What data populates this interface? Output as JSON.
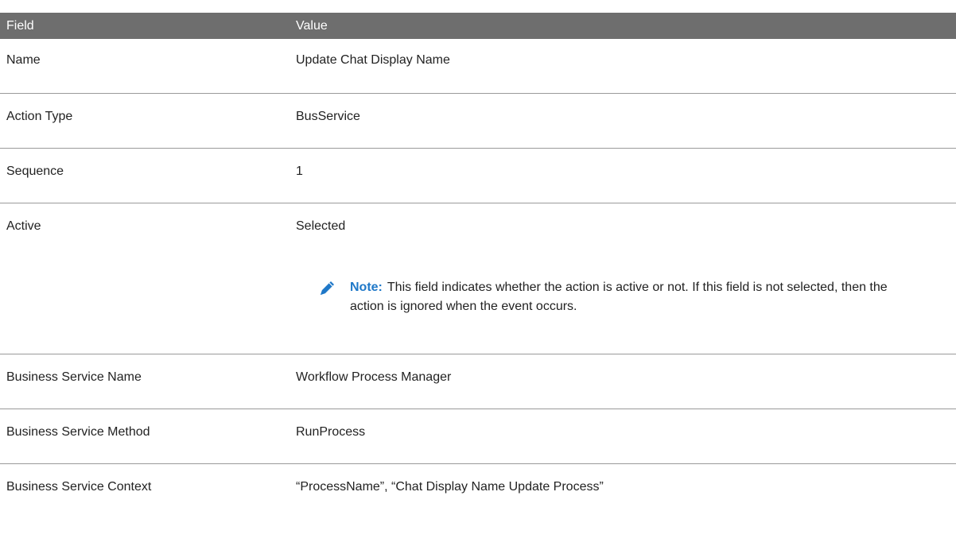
{
  "header": {
    "field_label": "Field",
    "value_label": "Value"
  },
  "rows": [
    {
      "field": "Name",
      "value": "Update Chat Display Name"
    },
    {
      "field": "Action Type",
      "value": "BusService"
    },
    {
      "field": "Sequence",
      "value": "1"
    },
    {
      "field": "Active",
      "value": "Selected"
    },
    {
      "field": "Business Service Name",
      "value": "Workflow Process Manager"
    },
    {
      "field": "Business Service Method",
      "value": "RunProcess"
    },
    {
      "field": "Business Service Context",
      "value": "“ProcessName”, “Chat Display Name Update Process”"
    }
  ],
  "note": {
    "label": "Note:",
    "text": "This field indicates whether the action is active or not. If this field is not selected, then the action is ignored when the event occurs.",
    "icon": "pencil-icon",
    "color": "#1f78c8"
  },
  "colors": {
    "header_bg": "#6e6e6e",
    "header_text": "#ffffff",
    "divider": "#9a9a9a"
  }
}
